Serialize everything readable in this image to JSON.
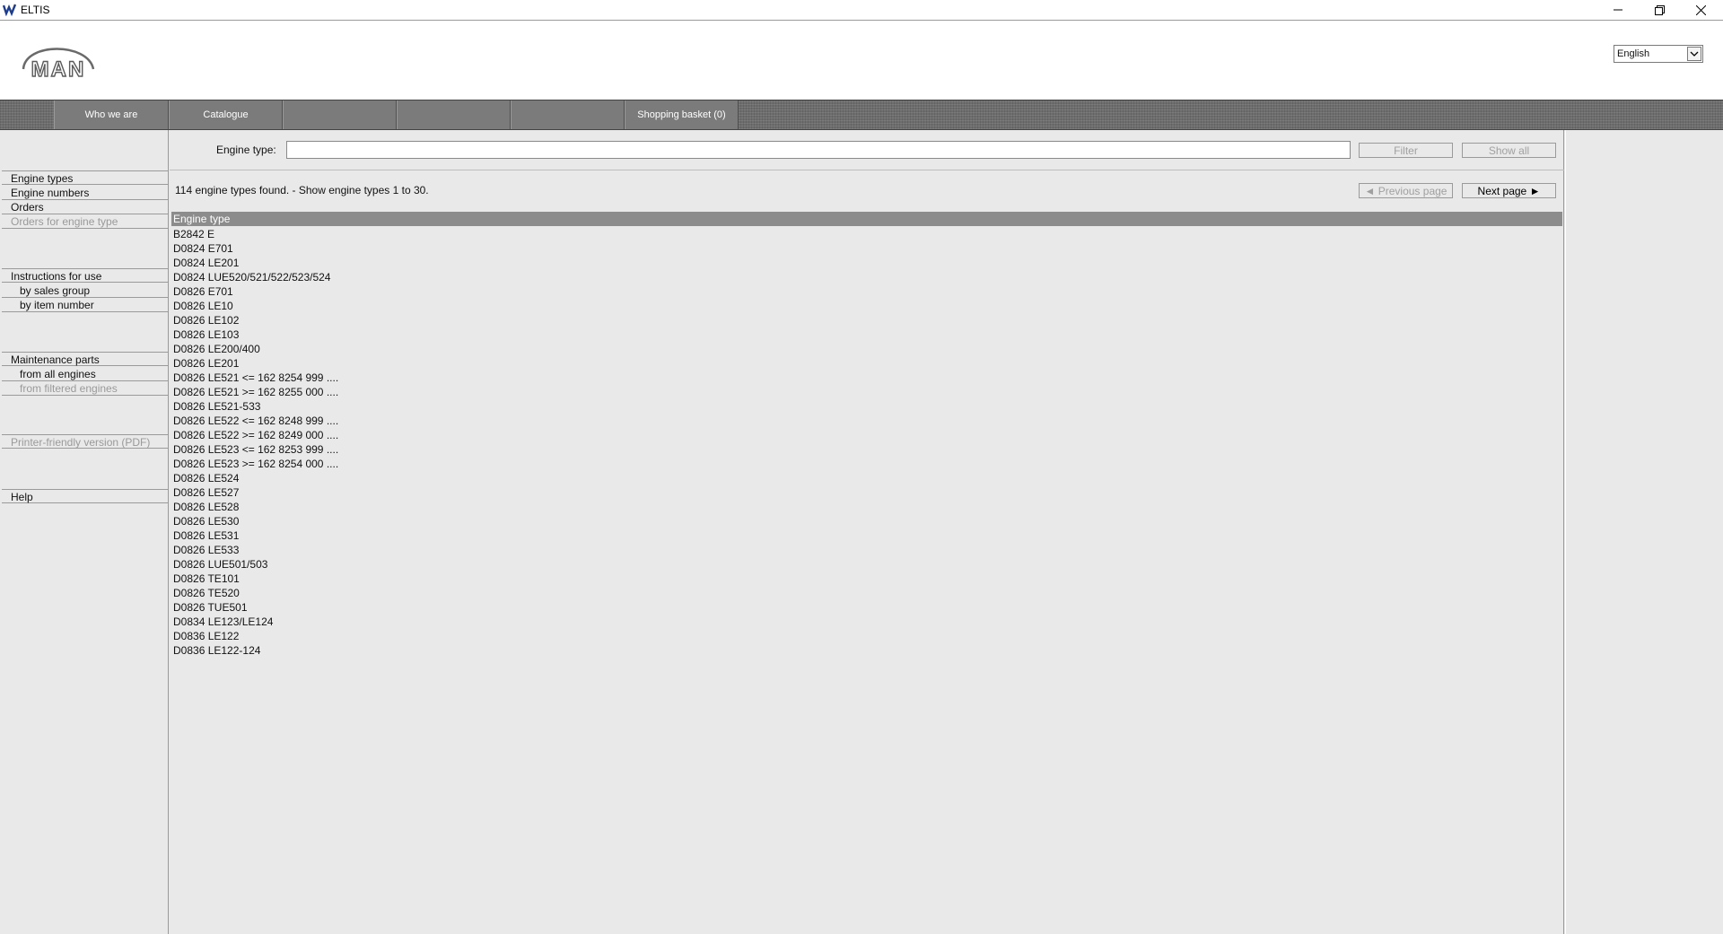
{
  "window": {
    "title": "ELTIS"
  },
  "header": {
    "logo_text": "MAN",
    "language": "English"
  },
  "nav": {
    "items": [
      "Who we are",
      "Catalogue",
      "",
      "",
      "",
      "Shopping basket (0)"
    ]
  },
  "sidebar": {
    "items": [
      {
        "label": "Engine types",
        "disabled": false
      },
      {
        "label": "Engine numbers",
        "disabled": false
      },
      {
        "label": "Orders",
        "disabled": false
      },
      {
        "label": "Orders for engine type",
        "disabled": true
      },
      {
        "label": "Instructions for use",
        "disabled": false
      },
      {
        "label": "by sales group",
        "disabled": false
      },
      {
        "label": "by item number",
        "disabled": false
      },
      {
        "label": "Maintenance parts",
        "disabled": false
      },
      {
        "label": "from all engines",
        "disabled": false
      },
      {
        "label": "from filtered engines",
        "disabled": true
      },
      {
        "label": "Printer-friendly version (PDF)",
        "disabled": true
      },
      {
        "label": "Help",
        "disabled": false
      }
    ]
  },
  "filter": {
    "label": "Engine type:",
    "value": "",
    "filter_button": "Filter",
    "show_all_button": "Show all"
  },
  "results": {
    "summary": "114 engine types found. - Show engine types 1 to 30.",
    "prev_button": "◄ Previous page",
    "next_button": "Next page ►",
    "column_header": "Engine type",
    "rows": [
      "B2842 E",
      "D0824 E701",
      "D0824 LE201",
      "D0824 LUE520/521/522/523/524",
      "D0826 E701",
      "D0826 LE10",
      "D0826 LE102",
      "D0826 LE103",
      "D0826 LE200/400",
      "D0826 LE201",
      "D0826 LE521 <= 162 8254 999 ....",
      "D0826 LE521 >= 162 8255 000 ....",
      "D0826 LE521-533",
      "D0826 LE522 <= 162 8248 999 ....",
      "D0826 LE522 >= 162 8249 000 ....",
      "D0826 LE523 <= 162 8253 999 ....",
      "D0826 LE523 >= 162 8254 000 ....",
      "D0826 LE524",
      "D0826 LE527",
      "D0826 LE528",
      "D0826 LE530",
      "D0826 LE531",
      "D0826 LE533",
      "D0826 LUE501/503",
      "D0826 TE101",
      "D0826 TE520",
      "D0826 TUE501",
      "D0834 LE123/LE124",
      "D0836 LE122",
      "D0836 LE122-124"
    ]
  }
}
